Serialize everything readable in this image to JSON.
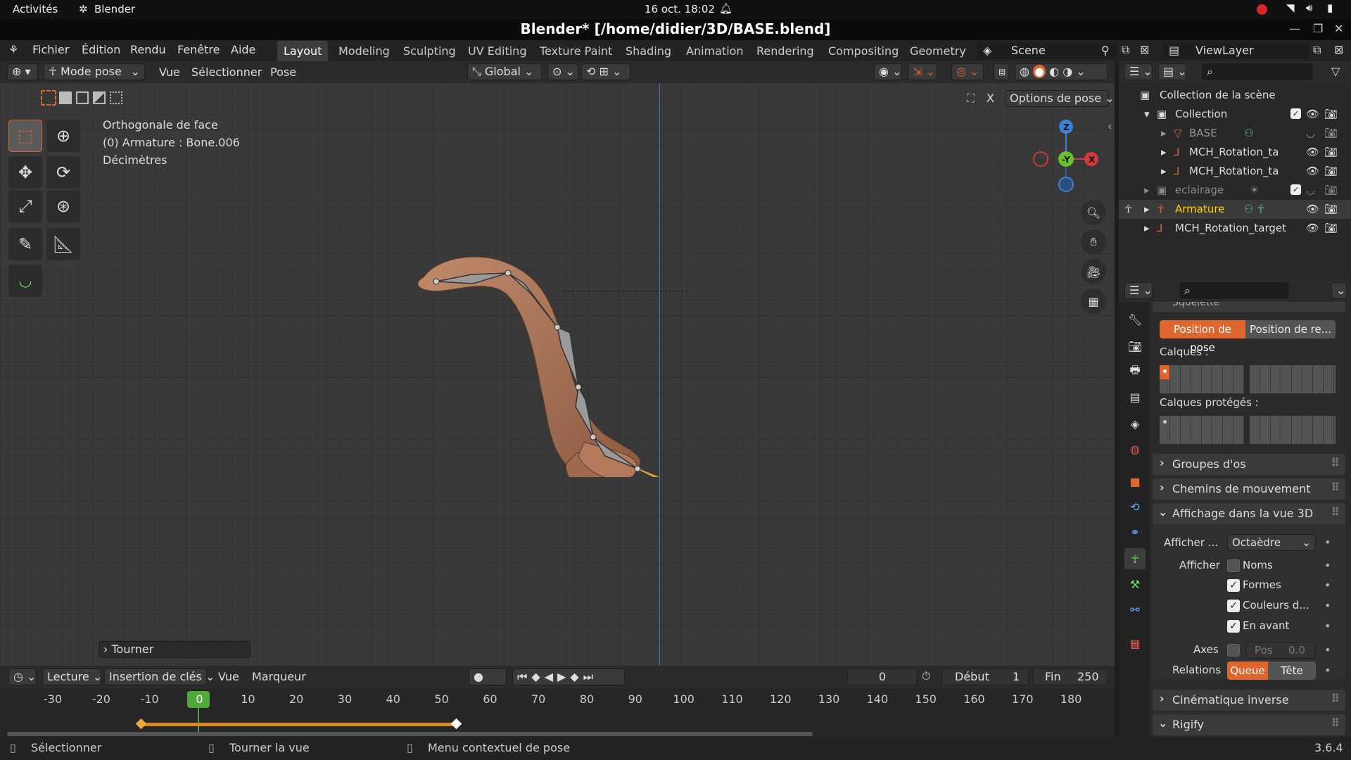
{
  "gnome": {
    "activities": "Activités",
    "app": "Blender",
    "datetime": "16 oct.  18:02"
  },
  "title": "Blender* [/home/didier/3D/BASE.blend]",
  "menus": [
    "Fichier",
    "Édition",
    "Rendu",
    "Fenêtre",
    "Aide"
  ],
  "workspaces": [
    "Layout",
    "Modeling",
    "Sculpting",
    "UV Editing",
    "Texture Paint",
    "Shading",
    "Animation",
    "Rendering",
    "Compositing",
    "Geometry N"
  ],
  "scene": "Scene",
  "viewlayer": "ViewLayer",
  "viewport_header": {
    "mode": "Mode pose",
    "menus": [
      "Vue",
      "Sélectionner",
      "Pose"
    ],
    "orientation": "Global",
    "pose_options": "Options de pose"
  },
  "overlay": {
    "view": "Orthogonale de face",
    "object": "(0) Armature : Bone.006",
    "units": "Décimètres"
  },
  "last_op": "Tourner",
  "outliner": {
    "root": "Collection de la scène",
    "rows": [
      {
        "label": "Collection",
        "indent": 1
      },
      {
        "label": "BASE",
        "indent": 2
      },
      {
        "label": "MCH_Rotation_ta",
        "indent": 2
      },
      {
        "label": "MCH_Rotation_ta",
        "indent": 2
      },
      {
        "label": "eclairage",
        "indent": 1
      },
      {
        "label": "Armature",
        "indent": 1
      },
      {
        "label": "MCH_Rotation_target",
        "indent": 1
      }
    ]
  },
  "props": {
    "section_top": "Squelette",
    "pose_position": "Position de pose",
    "rest_position": "Position de re...",
    "layers": "Calques :",
    "protected_layers": "Calques protégés :",
    "panels": [
      "Groupes d'os",
      "Chemins de mouvement",
      "Affichage dans la vue 3D"
    ],
    "display_as_label": "Afficher ...",
    "display_as": "Octaèdre",
    "show_label": "Afficher",
    "show_names": "Noms",
    "show_shapes": "Formes",
    "show_colors": "Couleurs d...",
    "in_front": "En avant",
    "axes_label": "Axes",
    "axes_pos": "Pos",
    "axes_val": "0.0",
    "relations_label": "Relations",
    "relations_tail": "Queue",
    "relations_head": "Tête",
    "panels_bottom": [
      "Cinématique inverse",
      "Rigify"
    ]
  },
  "timeline": {
    "playback": "Lecture",
    "keying": "Insertion de clés",
    "view": "Vue",
    "marker": "Marqueur",
    "current": "0",
    "start_label": "Début",
    "start": "1",
    "end_label": "Fin",
    "end": "250",
    "ticks": [
      "-30",
      "-20",
      "-10",
      "0",
      "10",
      "20",
      "30",
      "40",
      "50",
      "60",
      "70",
      "80",
      "90",
      "100",
      "110",
      "120",
      "130",
      "140",
      "150",
      "160",
      "170",
      "180"
    ]
  },
  "status": {
    "select": "Sélectionner",
    "rotate": "Tourner la vue",
    "context": "Menu contextuel de pose",
    "version": "3.6.4"
  },
  "colors": {
    "accent": "#e0662f",
    "active_tab": "#3d3d3d",
    "selected_text": "#ffd700",
    "bg": "#393939"
  }
}
